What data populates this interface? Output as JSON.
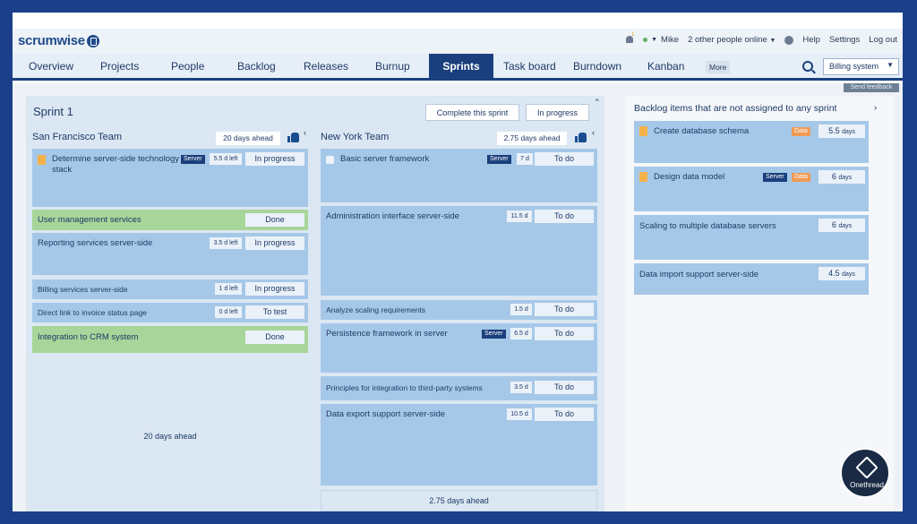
{
  "app": {
    "logo": "scrumwise"
  },
  "topbar": {
    "notifications": "1",
    "user": "Mike",
    "online": "2 other people online",
    "help": "Help",
    "settings": "Settings",
    "logout": "Log out"
  },
  "nav": {
    "items": [
      "Overview",
      "Projects",
      "People",
      "Backlog",
      "Releases",
      "Burnup",
      "Sprints",
      "Task board",
      "Burndown",
      "Kanban"
    ],
    "active": "Sprints",
    "more": "More",
    "project": "Billing system",
    "feedback": "Send feedback"
  },
  "sprint": {
    "title": "Sprint 1",
    "complete_btn": "Complete this sprint",
    "status_btn": "In progress"
  },
  "teams": [
    {
      "name": "San Francisco Team",
      "ahead": "20 days ahead",
      "footer": "20 days ahead",
      "items": [
        {
          "title": "Determine server-side technology stack",
          "tag": "Server",
          "est": "5.5 d left",
          "status": "In progress"
        },
        {
          "title": "User management services",
          "status": "Done"
        },
        {
          "title": "Reporting services server-side",
          "est": "3.5 d left",
          "status": "In progress"
        },
        {
          "title": "Billing services server-side",
          "est": "1 d left",
          "status": "In progress"
        },
        {
          "title": "Direct link to invoice status page",
          "est": "0 d left",
          "status": "To test"
        },
        {
          "title": "Integration to CRM system",
          "status": "Done"
        }
      ]
    },
    {
      "name": "New York Team",
      "ahead": "2.75 days ahead",
      "footer": "2.75 days ahead",
      "items": [
        {
          "title": "Basic server framework",
          "tag": "Server",
          "est": "7 d",
          "status": "To do"
        },
        {
          "title": "Administration interface server-side",
          "est": "11.5 d",
          "status": "To do"
        },
        {
          "title": "Analyze scaling requirements",
          "est": "1.5 d",
          "status": "To do"
        },
        {
          "title": "Persistence framework in server",
          "tag": "Server",
          "est": "6.5 d",
          "status": "To do"
        },
        {
          "title": "Principles for integration to third-party systems",
          "est": "3.5 d",
          "status": "To do"
        },
        {
          "title": "Data export support server-side",
          "est": "10.5 d",
          "status": "To do"
        }
      ]
    }
  ],
  "backlog": {
    "title": "Backlog items that are not assigned to any sprint",
    "days_unit": "days",
    "items": [
      {
        "title": "Create database schema",
        "tags": [
          "Data"
        ],
        "days": "5.5"
      },
      {
        "title": "Design data model",
        "tags": [
          "Server",
          "Data"
        ],
        "days": "6"
      },
      {
        "title": "Scaling to multiple database servers",
        "tags": [],
        "days": "6"
      },
      {
        "title": "Data import support server-side",
        "tags": [],
        "days": "4.5"
      }
    ]
  },
  "brand_badge": "Onethread",
  "colors": {
    "nav_active": "#1a3f7c",
    "card_blue": "#a6c8e8",
    "card_green": "#a8d59a",
    "tag_server": "#1a3f7c",
    "tag_data": "#ef9a55"
  }
}
